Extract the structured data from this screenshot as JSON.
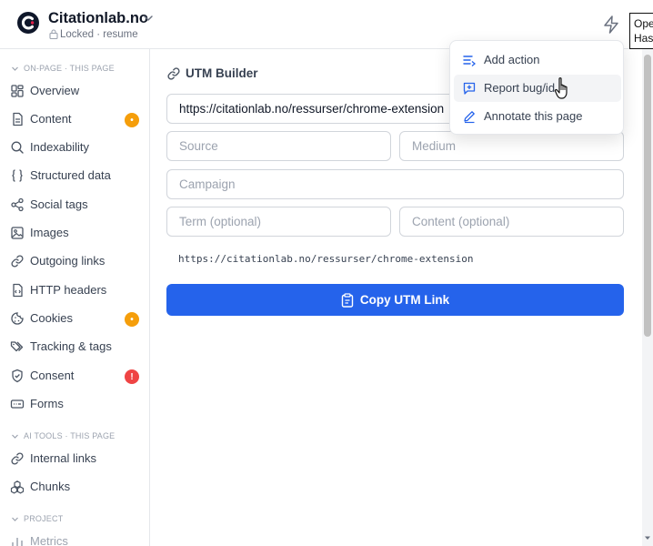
{
  "colors": {
    "brand": "#2563eb",
    "logo": "#0f172a",
    "logo_accent": "#e11d48",
    "badge_warning": "#f59e0b",
    "badge_error": "#ef4444"
  },
  "header": {
    "title": "Citationlab.no",
    "subtitle": "Locked · resume",
    "tooltip_line1": "Ope",
    "tooltip_line2": "Has"
  },
  "sidebar": {
    "section_onpage": "ON-PAGE · THIS PAGE",
    "section_ai": "AI TOOLS · THIS PAGE",
    "section_project": "PROJECT",
    "items": [
      {
        "label": "Overview",
        "icon": "layout-grid-icon"
      },
      {
        "label": "Content",
        "icon": "file-text-icon",
        "badge": "•"
      },
      {
        "label": "Indexability",
        "icon": "search-icon"
      },
      {
        "label": "Structured data",
        "icon": "braces-icon"
      },
      {
        "label": "Social tags",
        "icon": "share-icon"
      },
      {
        "label": "Images",
        "icon": "image-icon"
      },
      {
        "label": "Outgoing links",
        "icon": "link-icon"
      },
      {
        "label": "HTTP headers",
        "icon": "file-code-icon"
      },
      {
        "label": "Cookies",
        "icon": "cookie-icon",
        "badge": "•"
      },
      {
        "label": "Tracking & tags",
        "icon": "tags-icon"
      },
      {
        "label": "Consent",
        "icon": "shield-check-icon",
        "badge": "!"
      },
      {
        "label": "Forms",
        "icon": "form-icon"
      }
    ],
    "ai_items": [
      {
        "label": "Internal links",
        "icon": "link-icon"
      },
      {
        "label": "Chunks",
        "icon": "boxes-icon"
      }
    ],
    "project_items": [
      {
        "label": "Metrics",
        "icon": "chart-icon"
      }
    ]
  },
  "main": {
    "section_title": "UTM Builder",
    "url_value": "https://citationlab.no/ressurser/chrome-extension",
    "source_placeholder": "Source",
    "medium_placeholder": "Medium",
    "campaign_placeholder": "Campaign",
    "term_placeholder": "Term (optional)",
    "content_placeholder": "Content (optional)",
    "preview": "https://citationlab.no/ressurser/chrome-extension",
    "copy_button": "Copy UTM Link"
  },
  "menu": {
    "items": [
      {
        "label": "Add action",
        "icon": "list-plus-icon"
      },
      {
        "label": "Report bug/id",
        "icon": "message-plus-icon"
      },
      {
        "label": "Annotate this page",
        "icon": "pencil-icon"
      }
    ]
  }
}
